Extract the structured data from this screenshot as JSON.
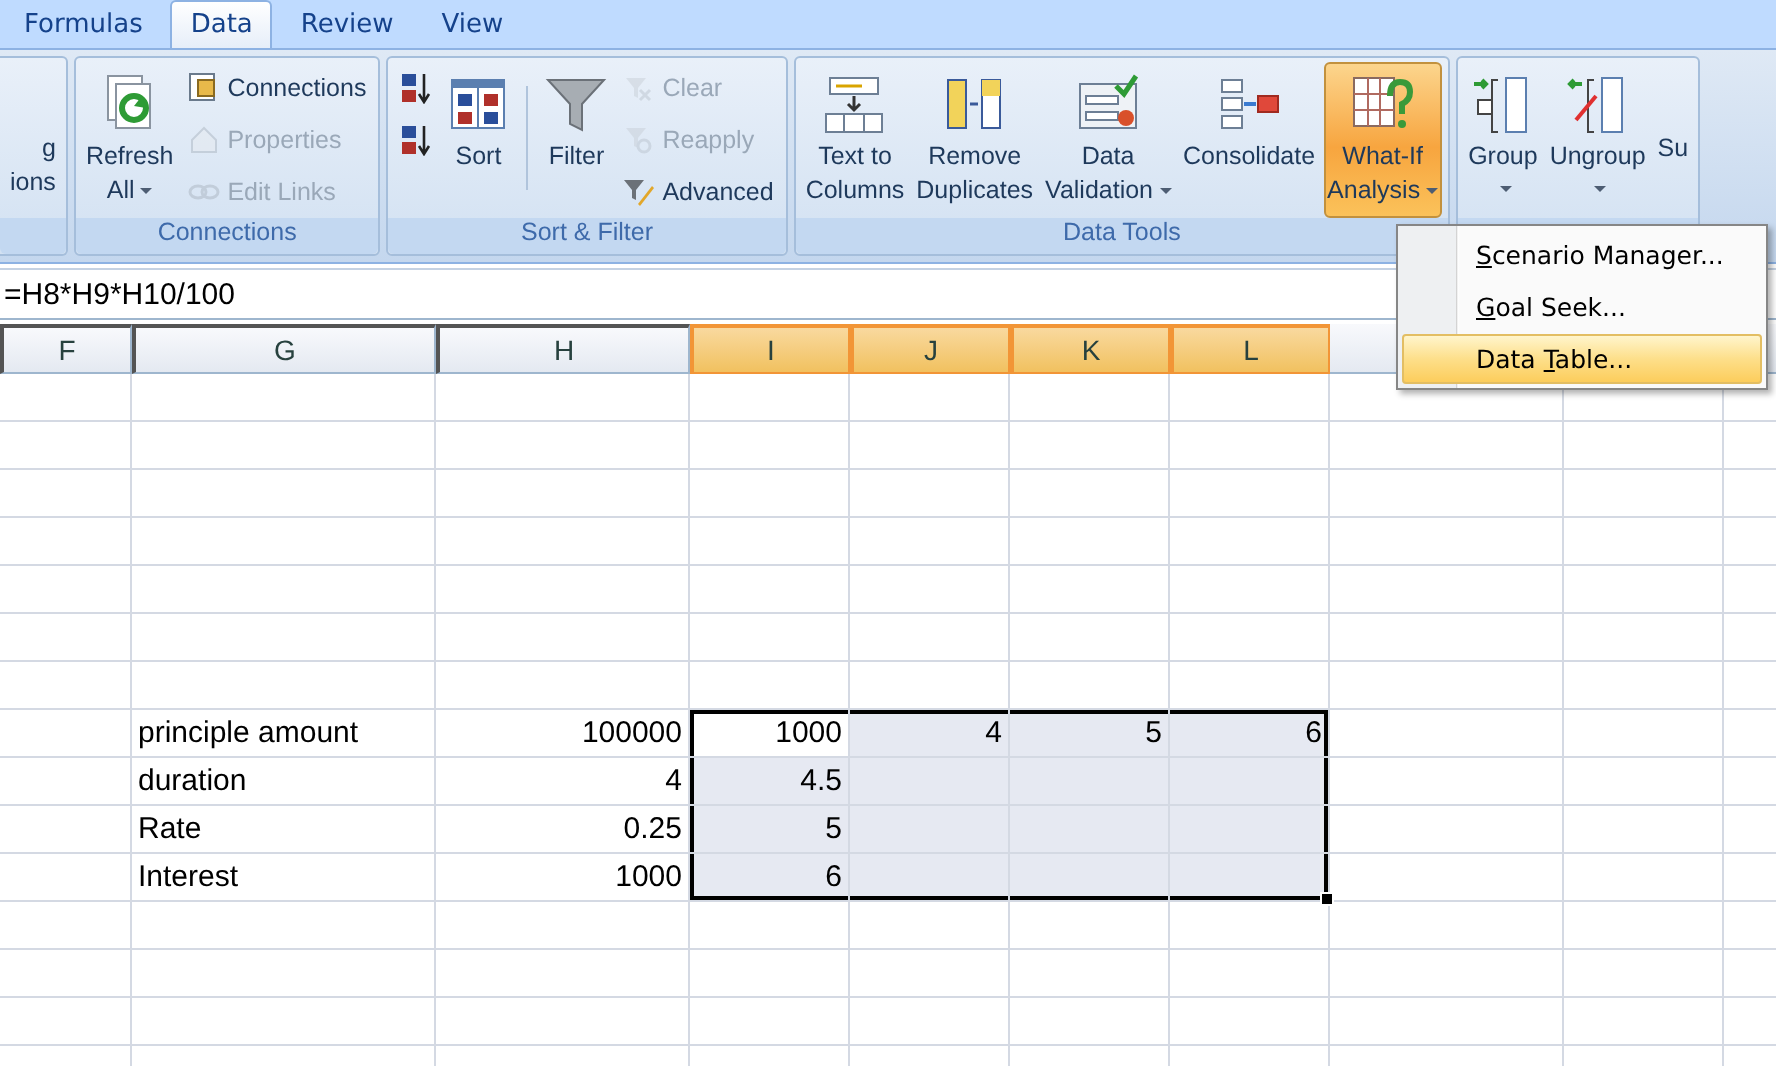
{
  "ribbon": {
    "tabs": [
      {
        "label": "Formulas",
        "selected": false
      },
      {
        "label": "Data",
        "selected": true
      },
      {
        "label": "Review",
        "selected": false
      },
      {
        "label": "View",
        "selected": false
      }
    ],
    "groups": [
      {
        "items": [
          {
            "kind": "large",
            "lines": [
              "g",
              "ions"
            ],
            "dropdown": false,
            "pressed": false
          }
        ]
      },
      {
        "label": "Connections",
        "items": [
          {
            "kind": "large",
            "lines": [
              "Refresh",
              "All"
            ],
            "dropdown": true,
            "pressed": false
          },
          {
            "kind": "stack",
            "buttons": [
              {
                "label": "Connections",
                "disabled": false
              },
              {
                "label": "Properties",
                "disabled": true
              },
              {
                "label": "Edit Links",
                "disabled": true
              }
            ]
          }
        ]
      },
      {
        "label": "Sort & Filter",
        "items": [
          {
            "kind": "stack",
            "buttons": [
              {
                "disabled": false
              },
              {
                "disabled": false
              }
            ]
          },
          {
            "kind": "large",
            "lines": [
              "Sort"
            ],
            "dropdown": false,
            "pressed": false
          },
          {
            "kind": "separator"
          },
          {
            "kind": "large",
            "lines": [
              "Filter"
            ],
            "dropdown": false,
            "pressed": false
          },
          {
            "kind": "stack",
            "buttons": [
              {
                "label": "Clear",
                "disabled": true
              },
              {
                "label": "Reapply",
                "disabled": true
              },
              {
                "label": "Advanced",
                "disabled": false
              }
            ]
          }
        ]
      },
      {
        "label": "Data Tools",
        "items": [
          {
            "kind": "large",
            "lines": [
              "Text to",
              "Columns"
            ],
            "dropdown": false,
            "pressed": false
          },
          {
            "kind": "large",
            "lines": [
              "Remove",
              "Duplicates"
            ],
            "dropdown": false,
            "pressed": false
          },
          {
            "kind": "large",
            "lines": [
              "Data",
              "Validation"
            ],
            "dropdown": true,
            "pressed": false
          },
          {
            "kind": "large",
            "lines": [
              "Consolidate"
            ],
            "dropdown": false,
            "pressed": false
          },
          {
            "kind": "large",
            "lines": [
              "What-If",
              "Analysis"
            ],
            "dropdown": true,
            "pressed": true
          }
        ]
      },
      {
        "items": [
          {
            "kind": "large",
            "lines": [
              "Group"
            ],
            "dropdown": true,
            "pressed": false
          },
          {
            "kind": "large",
            "lines": [
              "Ungroup"
            ],
            "dropdown": true,
            "pressed": false
          },
          {
            "kind": "large",
            "lines": [
              "Su"
            ],
            "dropdown": false,
            "pressed": false
          }
        ]
      }
    ]
  },
  "formula_bar": {
    "value": "=H8*H9*H10/100"
  },
  "sheet": {
    "columns": [
      {
        "label": "F",
        "selected": false
      },
      {
        "label": "G",
        "selected": false
      },
      {
        "label": "H",
        "selected": false
      },
      {
        "label": "I",
        "selected": true
      },
      {
        "label": "J",
        "selected": true
      },
      {
        "label": "K",
        "selected": true
      },
      {
        "label": "L",
        "selected": true
      }
    ],
    "rows": [
      {
        "label": "principle amount",
        "cells": [
          {
            "text": "100000",
            "selected": false,
            "active": false
          },
          {
            "text": "1000",
            "selected": true,
            "active": true
          },
          {
            "text": "4",
            "selected": true,
            "active": false
          },
          {
            "text": "5",
            "selected": true,
            "active": false
          },
          {
            "text": "6",
            "selected": true,
            "active": false
          }
        ]
      },
      {
        "label": "duration",
        "cells": [
          {
            "text": "4",
            "selected": false,
            "active": false
          },
          {
            "text": "4.5",
            "selected": true,
            "active": false
          },
          {
            "selected": true,
            "active": false
          },
          {
            "selected": true,
            "active": false
          },
          {
            "selected": true,
            "active": false
          }
        ]
      },
      {
        "label": "Rate",
        "cells": [
          {
            "text": "0.25",
            "selected": false,
            "active": false
          },
          {
            "text": "5",
            "selected": true,
            "active": false
          },
          {
            "selected": true,
            "active": false
          },
          {
            "selected": true,
            "active": false
          },
          {
            "selected": true,
            "active": false
          }
        ]
      },
      {
        "label": "Interest",
        "cells": [
          {
            "text": "1000",
            "selected": false,
            "active": false
          },
          {
            "text": "6",
            "selected": true,
            "active": false
          },
          {
            "selected": true,
            "active": false
          },
          {
            "selected": true,
            "active": false
          },
          {
            "selected": true,
            "active": false
          }
        ]
      }
    ]
  },
  "menu": {
    "items": [
      {
        "key": "S",
        "rest": "cenario Manager...",
        "selected": false
      },
      {
        "key": "G",
        "rest": "oal Seek...",
        "selected": false
      },
      {
        "prefix": "Data ",
        "key": "T",
        "rest": "able...",
        "selected": true
      }
    ]
  }
}
